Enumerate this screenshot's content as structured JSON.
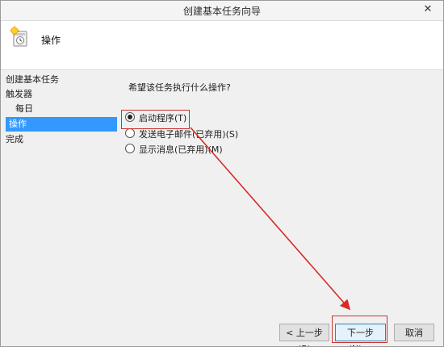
{
  "window": {
    "title": "创建基本任务向导",
    "close_glyph": "✕"
  },
  "header": {
    "title": "操作",
    "icon": "task-scheduler-icon"
  },
  "sidebar": {
    "items": [
      {
        "label": "创建基本任务"
      },
      {
        "label": "触发器"
      },
      {
        "label": "每日"
      },
      {
        "label": "操作"
      },
      {
        "label": "完成"
      }
    ]
  },
  "content": {
    "question": "希望该任务执行什么操作?",
    "options": [
      {
        "label": "启动程序(T)",
        "selected": true
      },
      {
        "label": "发送电子邮件(已弃用)(S)",
        "selected": false
      },
      {
        "label": "显示消息(已弃用)(M)",
        "selected": false
      }
    ]
  },
  "buttons": {
    "back": "< 上一步(B)",
    "next": "下一步(N) >",
    "cancel": "取消"
  },
  "annotation": {
    "color": "#c9342f"
  }
}
